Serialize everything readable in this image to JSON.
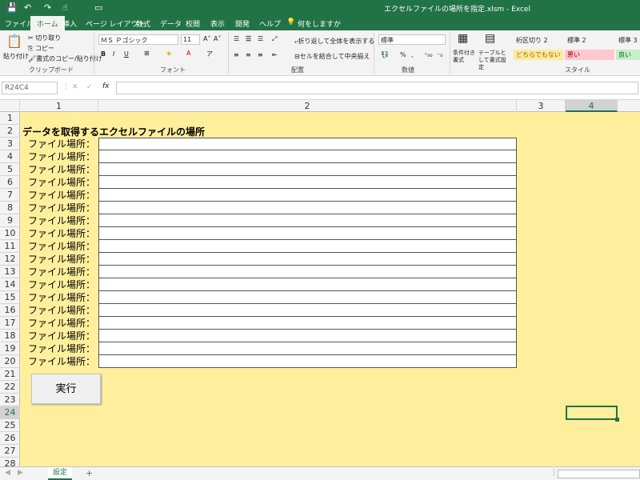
{
  "window": {
    "title": "エクセルファイルの場所を指定.xlsm  -  Excel"
  },
  "qat": {
    "save_icon": "save-icon",
    "undo_icon": "undo-icon",
    "redo_icon": "redo-icon",
    "touch_icon": "touch-mode-icon"
  },
  "tabs": [
    "ファイル",
    "ホーム",
    "挿入",
    "ページ レイアウト",
    "数式",
    "データ",
    "校閲",
    "表示",
    "開発",
    "ヘルプ",
    "何をしますか"
  ],
  "ribbon": {
    "clipboard": {
      "group": "クリップボード",
      "paste": "貼り付け",
      "cut": "切り取り",
      "copy": "コピー",
      "format_painter": "書式のコピー/貼り付け"
    },
    "font": {
      "group": "フォント",
      "font_name": "ＭＳ Ｐゴシック",
      "font_size": "11",
      "bold": "B",
      "italic": "I",
      "underline": "U"
    },
    "alignment": {
      "group": "配置",
      "wrap": "折り返して全体を表示する",
      "merge": "セルを結合して中央揃え"
    },
    "number": {
      "group": "数値",
      "format": "標準",
      "percent": "%"
    },
    "styles": {
      "group": "スタイル",
      "cond_format": "条件付き書式",
      "table_format": "テーブルとして書式設定",
      "s1": "桁区切り 2",
      "s2": "標準 2",
      "s3": "標準 3",
      "s4": "どちらでもない",
      "s5": "悪い",
      "s6": "良い"
    }
  },
  "formula_bar": {
    "name_box": "R24C4",
    "fx": "fx"
  },
  "columns": [
    "1",
    "2",
    "3",
    "4"
  ],
  "rows": [
    "1",
    "2",
    "3",
    "4",
    "5",
    "6",
    "7",
    "8",
    "9",
    "10",
    "11",
    "12",
    "13",
    "14",
    "15",
    "16",
    "17",
    "18",
    "19",
    "20",
    "21",
    "22",
    "23",
    "24",
    "25",
    "26",
    "27",
    "28"
  ],
  "sheet": {
    "heading": "データを取得するエクセルファイルの場所",
    "row_label": "ファイル場所：",
    "run_button": "実行"
  },
  "sheet_tabs": {
    "active": "設定",
    "add": "+"
  },
  "colors": {
    "accent": "#217346",
    "sheet_bg": "#ffef9c"
  }
}
